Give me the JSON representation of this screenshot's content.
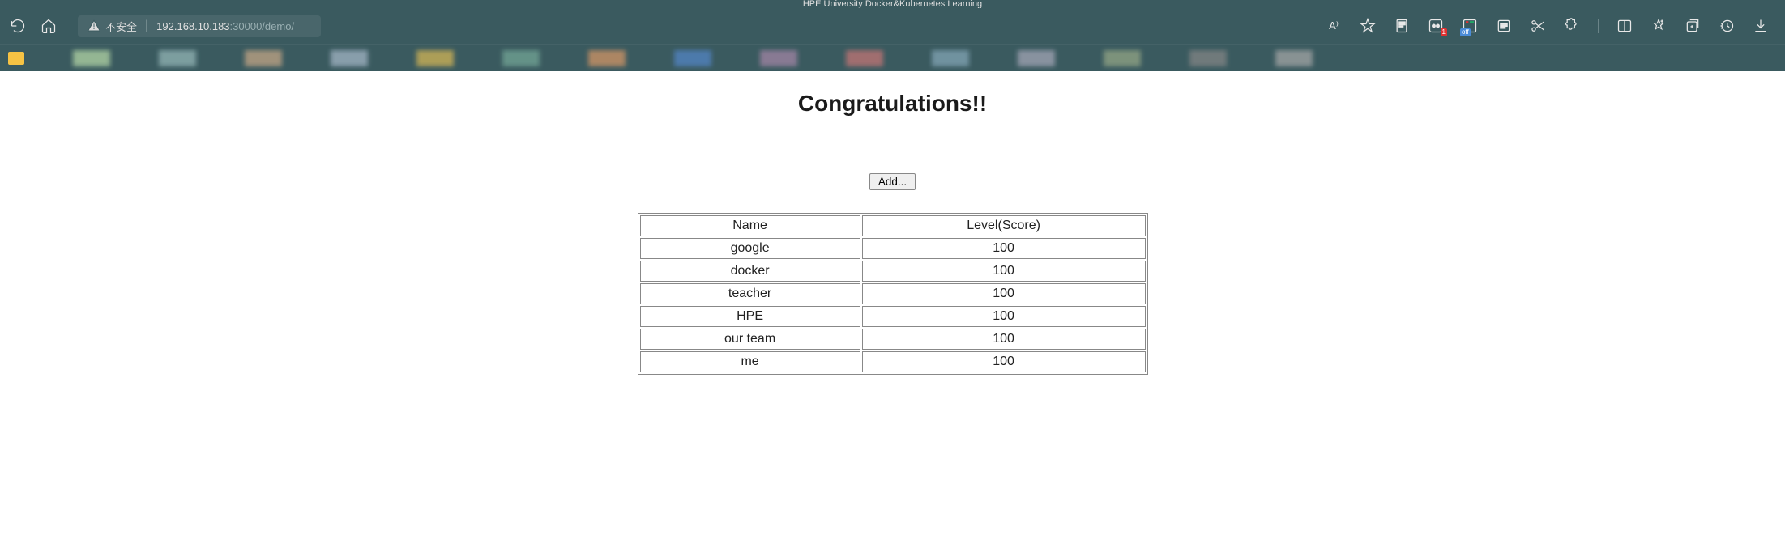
{
  "browser": {
    "tab_title": "HPE University Docker&Kubernetes Learning",
    "security_label": "不安全",
    "url_host": "192.168.10.183",
    "url_port_path": ":30000/demo/",
    "read_aloud": "A⁾",
    "badge_count": "1",
    "off_label": "off"
  },
  "page": {
    "heading": "Congratulations!!",
    "add_button_label": "Add...",
    "columns": {
      "name": "Name",
      "score": "Level(Score)"
    },
    "rows": [
      {
        "name": "google",
        "score": "100"
      },
      {
        "name": "docker",
        "score": "100"
      },
      {
        "name": "teacher",
        "score": "100"
      },
      {
        "name": "HPE",
        "score": "100"
      },
      {
        "name": "our team",
        "score": "100"
      },
      {
        "name": "me",
        "score": "100"
      }
    ]
  }
}
